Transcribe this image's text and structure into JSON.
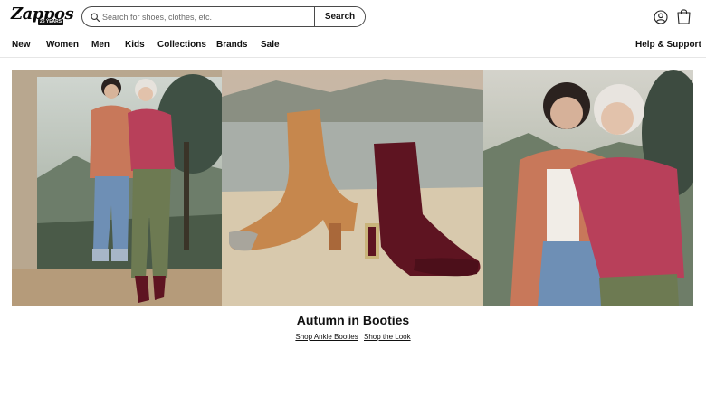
{
  "header": {
    "logo_text": "Zappos",
    "logo_badge": "25 YEARS",
    "search": {
      "placeholder": "Search for shoes, clothes, etc.",
      "value": "",
      "button_label": "Search"
    }
  },
  "nav": {
    "items": [
      {
        "label": "New"
      },
      {
        "label": "Women"
      },
      {
        "label": "Men"
      },
      {
        "label": "Kids"
      },
      {
        "label": "Collections"
      },
      {
        "label": "Brands"
      },
      {
        "label": "Sale"
      }
    ],
    "help_label": "Help & Support"
  },
  "hero": {
    "title": "Autumn in Booties",
    "links": [
      {
        "label": "Shop Ankle Booties"
      },
      {
        "label": "Shop the Look"
      }
    ]
  },
  "icons": {
    "search": "search-icon",
    "account": "account-icon",
    "cart": "shopping-bag-icon"
  },
  "colors": {
    "text": "#111111",
    "border": "#4a4a4a",
    "sweater_pink": "#b8405a",
    "boot_tan": "#c6874d",
    "boot_burgundy": "#5e1421"
  }
}
